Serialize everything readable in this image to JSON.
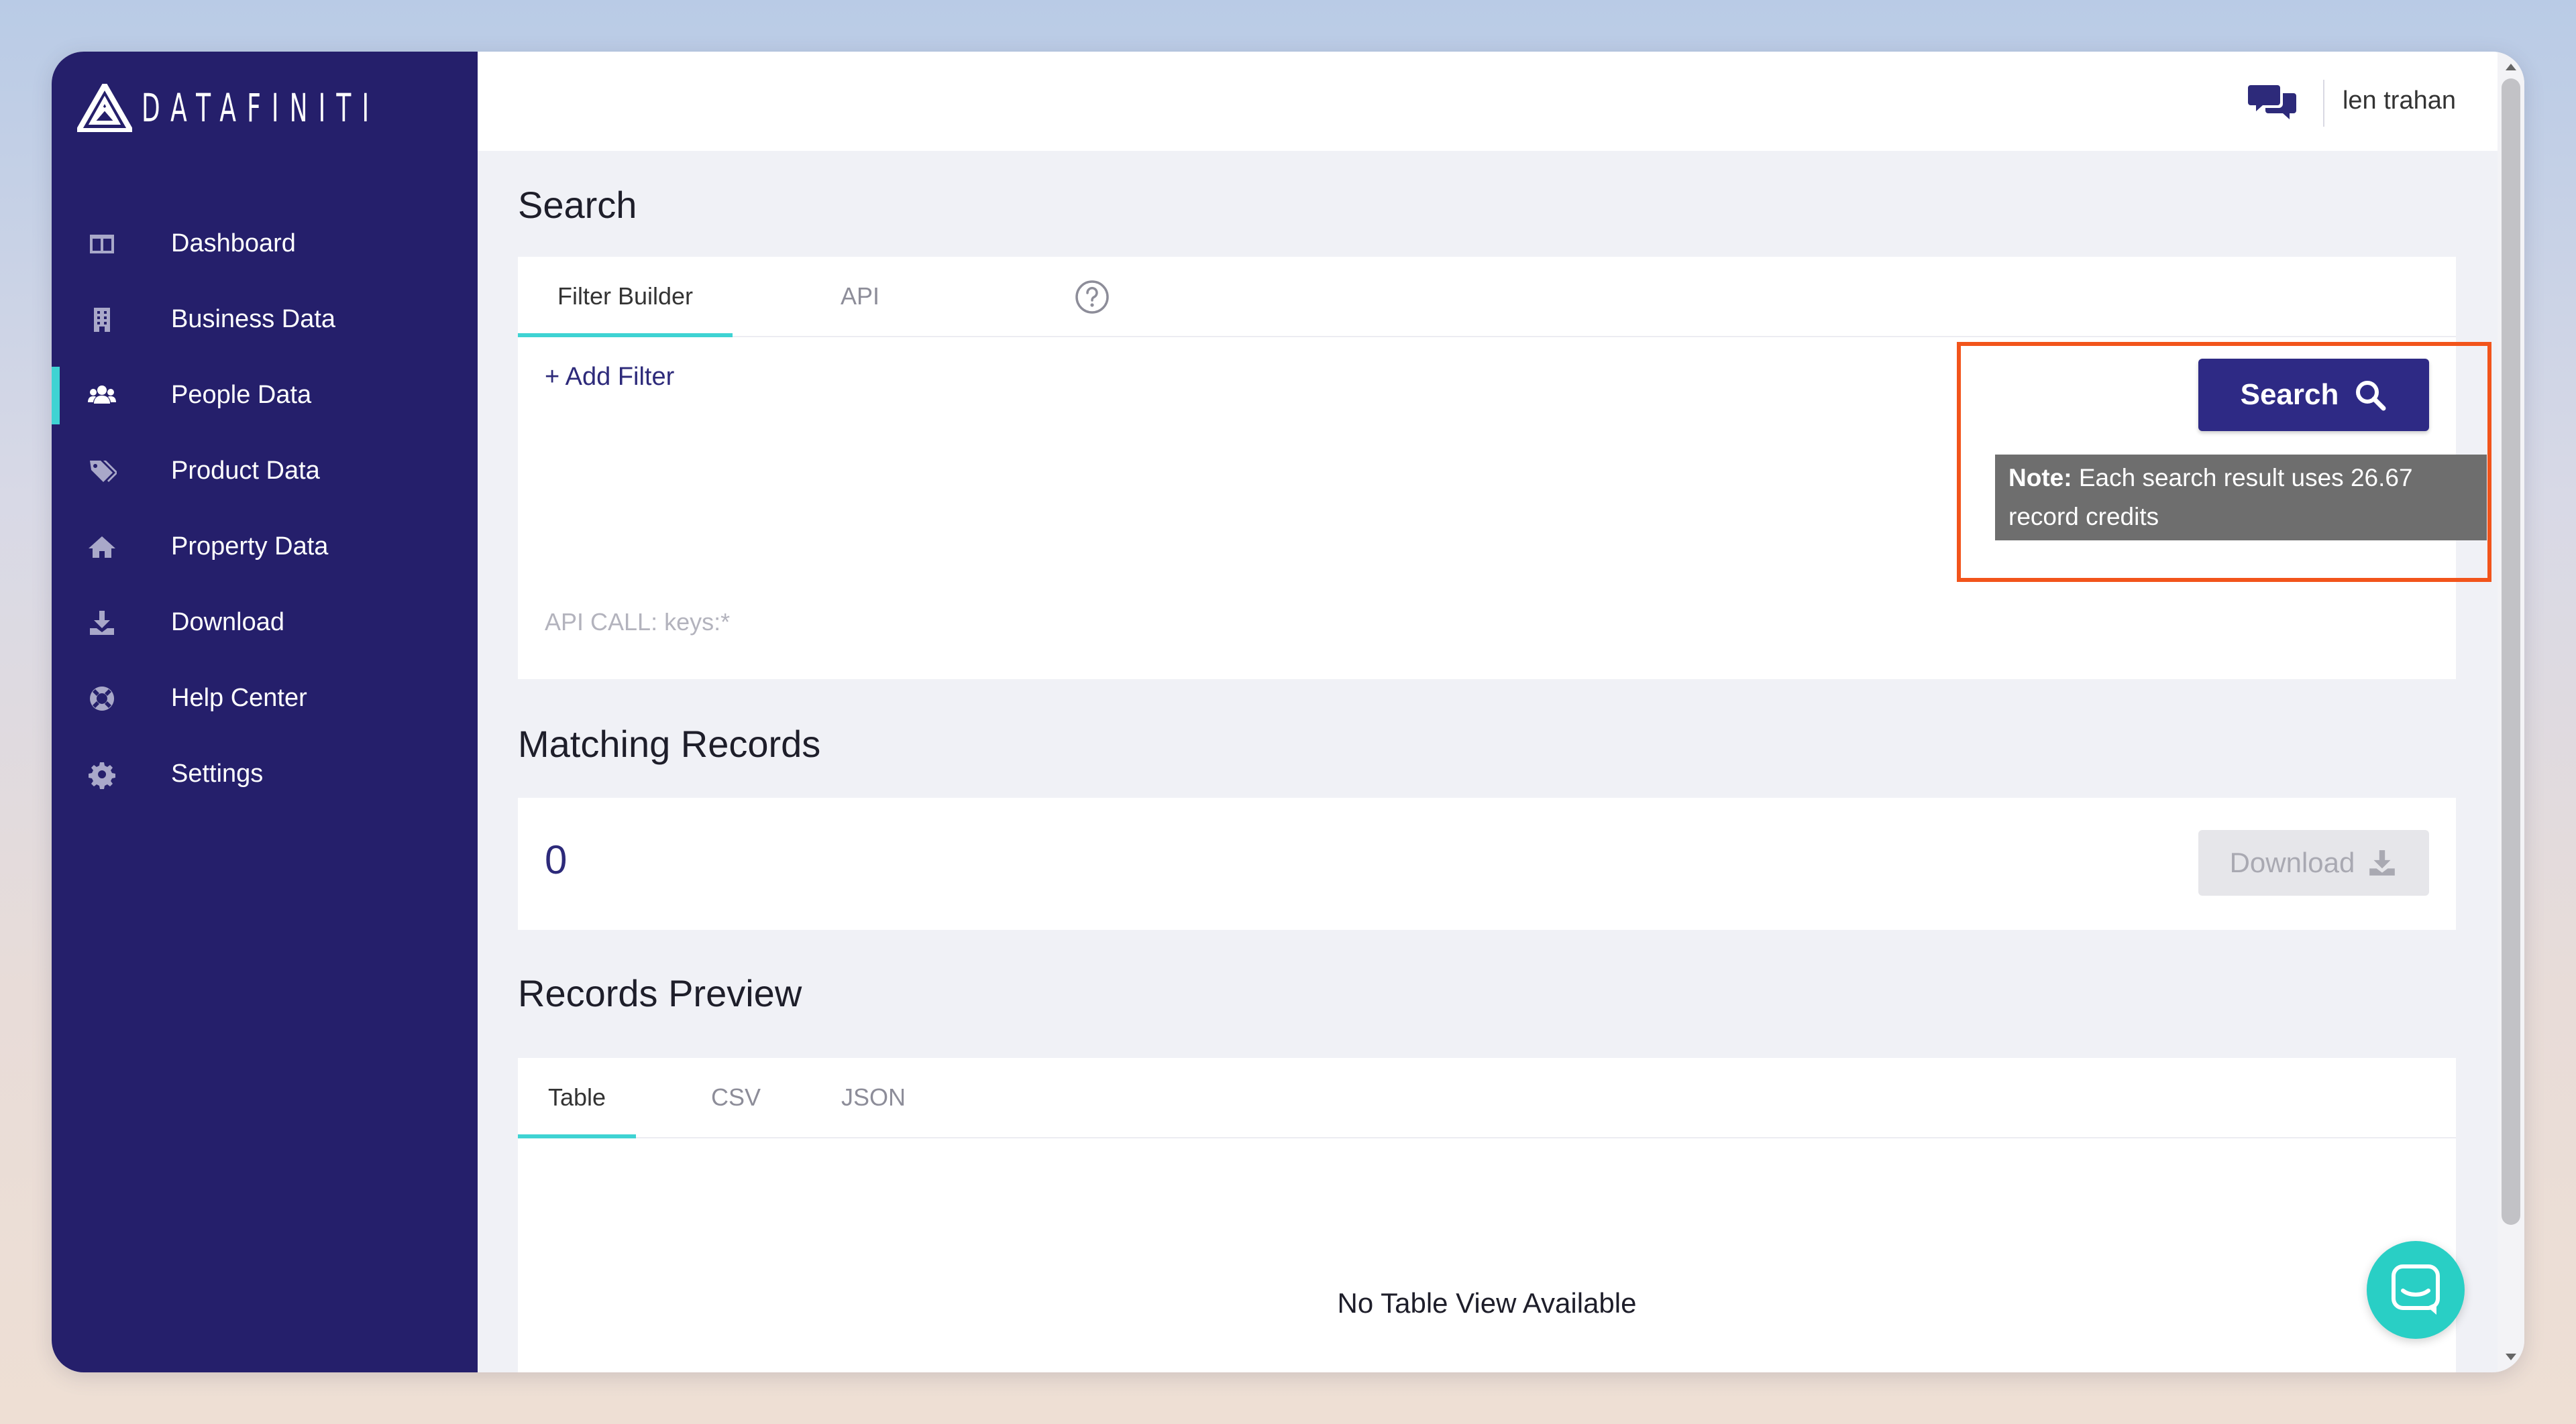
{
  "brand": {
    "name": "DATAFINITI"
  },
  "sidebar": {
    "items": [
      {
        "label": "Dashboard",
        "icon": "dashboard-icon",
        "active": false
      },
      {
        "label": "Business Data",
        "icon": "building-icon",
        "active": false
      },
      {
        "label": "People Data",
        "icon": "users-icon",
        "active": true
      },
      {
        "label": "Product Data",
        "icon": "tags-icon",
        "active": false
      },
      {
        "label": "Property Data",
        "icon": "home-icon",
        "active": false
      },
      {
        "label": "Download",
        "icon": "download-icon",
        "active": false
      },
      {
        "label": "Help Center",
        "icon": "lifebuoy-icon",
        "active": false
      },
      {
        "label": "Settings",
        "icon": "gear-icon",
        "active": false
      }
    ]
  },
  "header": {
    "user_name": "len trahan"
  },
  "search": {
    "title": "Search",
    "tabs": [
      {
        "label": "Filter Builder",
        "active": true
      },
      {
        "label": "API",
        "active": false
      }
    ],
    "add_filter": "+ Add Filter",
    "button_label": "Search",
    "note_label": "Note:",
    "note_text": " Each search result uses 26.67 record credits",
    "api_call": "API CALL: keys:*"
  },
  "matching": {
    "title": "Matching Records",
    "count": "0",
    "download_label": "Download"
  },
  "preview": {
    "title": "Records Preview",
    "tabs": [
      {
        "label": "Table",
        "active": true
      },
      {
        "label": "CSV",
        "active": false
      },
      {
        "label": "JSON",
        "active": false
      }
    ],
    "empty_message": "No Table View Available"
  },
  "colors": {
    "sidebar_bg": "#251f6b",
    "accent_teal": "#3fd3d3",
    "primary_button": "#2e2a85",
    "highlight": "#f2541b",
    "tooltip_bg": "#6e6e6e",
    "launcher": "#29cfc5"
  }
}
